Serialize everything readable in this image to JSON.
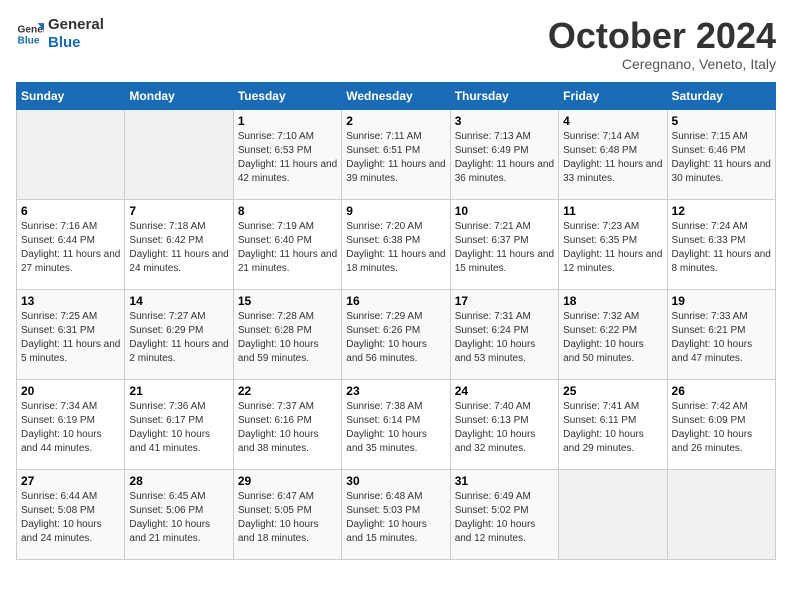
{
  "logo": {
    "line1": "General",
    "line2": "Blue"
  },
  "title": "October 2024",
  "subtitle": "Ceregnano, Veneto, Italy",
  "days_of_week": [
    "Sunday",
    "Monday",
    "Tuesday",
    "Wednesday",
    "Thursday",
    "Friday",
    "Saturday"
  ],
  "weeks": [
    [
      {
        "day": "",
        "info": ""
      },
      {
        "day": "",
        "info": ""
      },
      {
        "day": "1",
        "info": "Sunrise: 7:10 AM\nSunset: 6:53 PM\nDaylight: 11 hours and 42 minutes."
      },
      {
        "day": "2",
        "info": "Sunrise: 7:11 AM\nSunset: 6:51 PM\nDaylight: 11 hours and 39 minutes."
      },
      {
        "day": "3",
        "info": "Sunrise: 7:13 AM\nSunset: 6:49 PM\nDaylight: 11 hours and 36 minutes."
      },
      {
        "day": "4",
        "info": "Sunrise: 7:14 AM\nSunset: 6:48 PM\nDaylight: 11 hours and 33 minutes."
      },
      {
        "day": "5",
        "info": "Sunrise: 7:15 AM\nSunset: 6:46 PM\nDaylight: 11 hours and 30 minutes."
      }
    ],
    [
      {
        "day": "6",
        "info": "Sunrise: 7:16 AM\nSunset: 6:44 PM\nDaylight: 11 hours and 27 minutes."
      },
      {
        "day": "7",
        "info": "Sunrise: 7:18 AM\nSunset: 6:42 PM\nDaylight: 11 hours and 24 minutes."
      },
      {
        "day": "8",
        "info": "Sunrise: 7:19 AM\nSunset: 6:40 PM\nDaylight: 11 hours and 21 minutes."
      },
      {
        "day": "9",
        "info": "Sunrise: 7:20 AM\nSunset: 6:38 PM\nDaylight: 11 hours and 18 minutes."
      },
      {
        "day": "10",
        "info": "Sunrise: 7:21 AM\nSunset: 6:37 PM\nDaylight: 11 hours and 15 minutes."
      },
      {
        "day": "11",
        "info": "Sunrise: 7:23 AM\nSunset: 6:35 PM\nDaylight: 11 hours and 12 minutes."
      },
      {
        "day": "12",
        "info": "Sunrise: 7:24 AM\nSunset: 6:33 PM\nDaylight: 11 hours and 8 minutes."
      }
    ],
    [
      {
        "day": "13",
        "info": "Sunrise: 7:25 AM\nSunset: 6:31 PM\nDaylight: 11 hours and 5 minutes."
      },
      {
        "day": "14",
        "info": "Sunrise: 7:27 AM\nSunset: 6:29 PM\nDaylight: 11 hours and 2 minutes."
      },
      {
        "day": "15",
        "info": "Sunrise: 7:28 AM\nSunset: 6:28 PM\nDaylight: 10 hours and 59 minutes."
      },
      {
        "day": "16",
        "info": "Sunrise: 7:29 AM\nSunset: 6:26 PM\nDaylight: 10 hours and 56 minutes."
      },
      {
        "day": "17",
        "info": "Sunrise: 7:31 AM\nSunset: 6:24 PM\nDaylight: 10 hours and 53 minutes."
      },
      {
        "day": "18",
        "info": "Sunrise: 7:32 AM\nSunset: 6:22 PM\nDaylight: 10 hours and 50 minutes."
      },
      {
        "day": "19",
        "info": "Sunrise: 7:33 AM\nSunset: 6:21 PM\nDaylight: 10 hours and 47 minutes."
      }
    ],
    [
      {
        "day": "20",
        "info": "Sunrise: 7:34 AM\nSunset: 6:19 PM\nDaylight: 10 hours and 44 minutes."
      },
      {
        "day": "21",
        "info": "Sunrise: 7:36 AM\nSunset: 6:17 PM\nDaylight: 10 hours and 41 minutes."
      },
      {
        "day": "22",
        "info": "Sunrise: 7:37 AM\nSunset: 6:16 PM\nDaylight: 10 hours and 38 minutes."
      },
      {
        "day": "23",
        "info": "Sunrise: 7:38 AM\nSunset: 6:14 PM\nDaylight: 10 hours and 35 minutes."
      },
      {
        "day": "24",
        "info": "Sunrise: 7:40 AM\nSunset: 6:13 PM\nDaylight: 10 hours and 32 minutes."
      },
      {
        "day": "25",
        "info": "Sunrise: 7:41 AM\nSunset: 6:11 PM\nDaylight: 10 hours and 29 minutes."
      },
      {
        "day": "26",
        "info": "Sunrise: 7:42 AM\nSunset: 6:09 PM\nDaylight: 10 hours and 26 minutes."
      }
    ],
    [
      {
        "day": "27",
        "info": "Sunrise: 6:44 AM\nSunset: 5:08 PM\nDaylight: 10 hours and 24 minutes."
      },
      {
        "day": "28",
        "info": "Sunrise: 6:45 AM\nSunset: 5:06 PM\nDaylight: 10 hours and 21 minutes."
      },
      {
        "day": "29",
        "info": "Sunrise: 6:47 AM\nSunset: 5:05 PM\nDaylight: 10 hours and 18 minutes."
      },
      {
        "day": "30",
        "info": "Sunrise: 6:48 AM\nSunset: 5:03 PM\nDaylight: 10 hours and 15 minutes."
      },
      {
        "day": "31",
        "info": "Sunrise: 6:49 AM\nSunset: 5:02 PM\nDaylight: 10 hours and 12 minutes."
      },
      {
        "day": "",
        "info": ""
      },
      {
        "day": "",
        "info": ""
      }
    ]
  ]
}
